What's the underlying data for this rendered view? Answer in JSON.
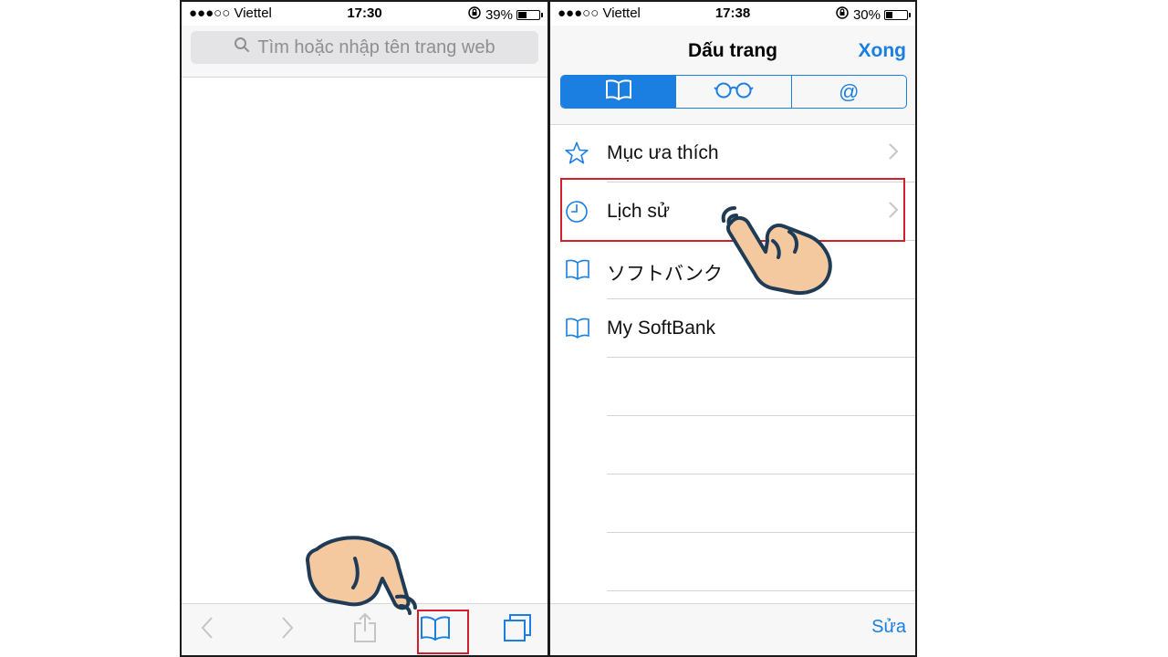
{
  "left_phone": {
    "status": {
      "carrier": "●●●○○ Viettel",
      "time": "17:30",
      "battery": "39%",
      "battery_level": 0.39
    },
    "search": {
      "placeholder": "Tìm hoặc nhập tên trang web"
    },
    "toolbar": {
      "icons": [
        "back-icon",
        "forward-icon",
        "share-icon",
        "bookmarks-icon",
        "tabs-icon"
      ],
      "highlighted": "bookmarks-icon"
    }
  },
  "right_phone": {
    "status": {
      "carrier": "●●●○○ Viettel",
      "time": "17:38",
      "battery": "30%",
      "battery_level": 0.3
    },
    "nav": {
      "title": "Dấu trang",
      "done_label": "Xong"
    },
    "segments": [
      {
        "icon": "book-icon",
        "label": "",
        "active": true
      },
      {
        "icon": "glasses-icon",
        "label": "",
        "active": false
      },
      {
        "icon": "at-icon",
        "label": "@",
        "active": false
      }
    ],
    "list": [
      {
        "icon": "star-icon",
        "label": "Mục ưa thích",
        "chevron": true
      },
      {
        "icon": "clock-icon",
        "label": "Lịch sử",
        "chevron": true,
        "highlighted": true
      },
      {
        "icon": "book-icon",
        "label": "ソフトバンク",
        "chevron": false
      },
      {
        "icon": "book-icon",
        "label": "My SoftBank",
        "chevron": false
      }
    ],
    "edit_label": "Sửa"
  },
  "colors": {
    "accent": "#1a7fe0",
    "highlight": "#d0202a",
    "hand_fill": "#f5c9a0",
    "hand_outline": "#1f3b55"
  }
}
